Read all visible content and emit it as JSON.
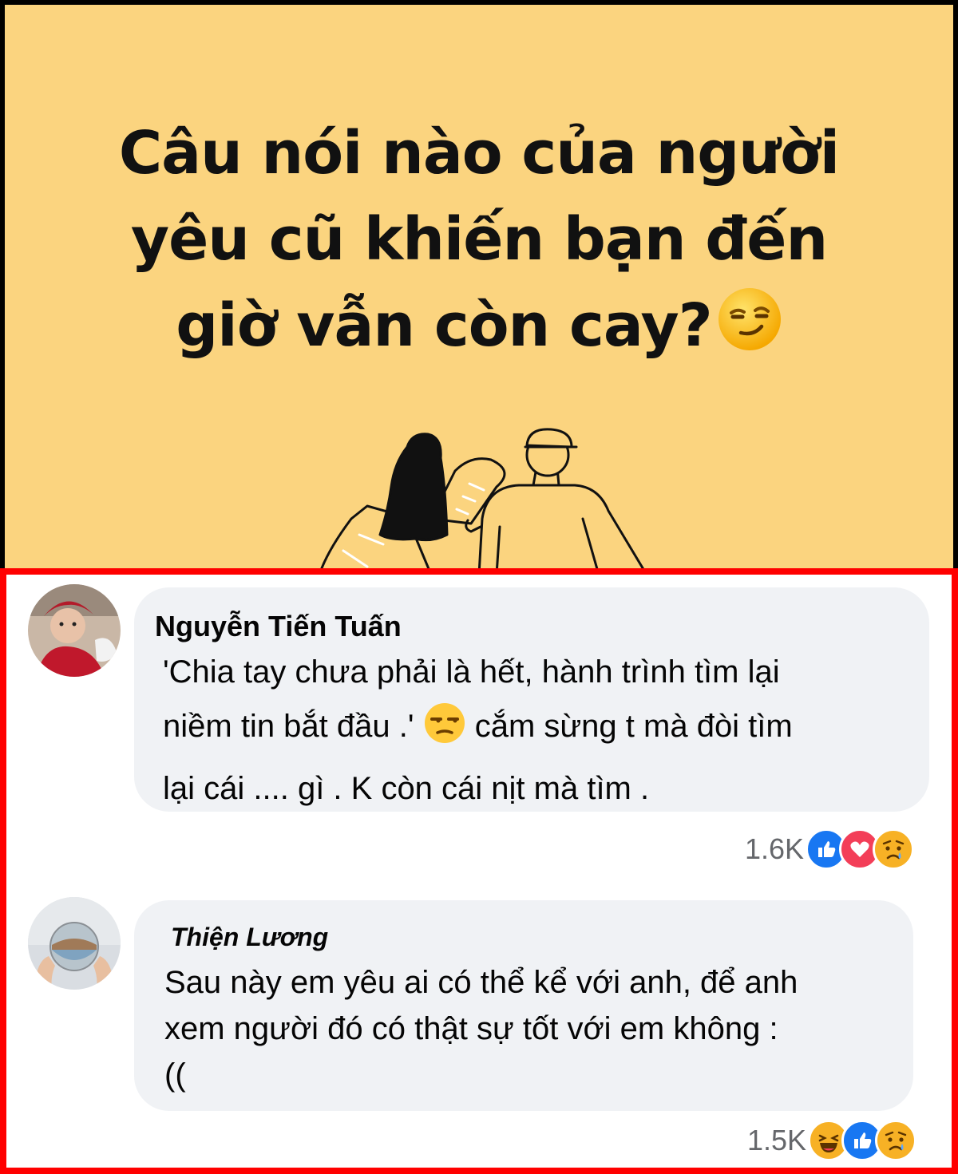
{
  "post": {
    "headline_lines": [
      "Câu nói nào của người",
      "yêu cũ khiến bạn đến",
      "giờ vẫn còn cay?"
    ],
    "headline_emoji": "smirk-emoji",
    "background": "#fbd47f"
  },
  "comments": [
    {
      "author": "Nguyễn Tiến Tuấn",
      "text_lines": [
        "'Chia tay chưa phải là hết, hành trình tìm lại",
        "niềm tin bắt đầu .' ",
        " cắm sừng t mà đòi tìm",
        "lại cái .... gì . K còn cái nịt mà tìm ."
      ],
      "inline_emoji": "unamused-emoji",
      "reaction_count": "1.6K",
      "reactions": [
        "like",
        "love",
        "sad"
      ]
    },
    {
      "author": "Thiện Lương",
      "text_lines": [
        "Sau này em yêu ai có thể kể với anh, để anh",
        "xem người đó có thật sự tốt với em không :",
        "(("
      ],
      "reaction_count": "1.5K",
      "reactions": [
        "haha",
        "like",
        "sad"
      ]
    }
  ],
  "colors": {
    "highlight_border": "#ff0000",
    "like": "#1877f2",
    "love": "#f33e58",
    "bubble": "#f0f2f5"
  }
}
